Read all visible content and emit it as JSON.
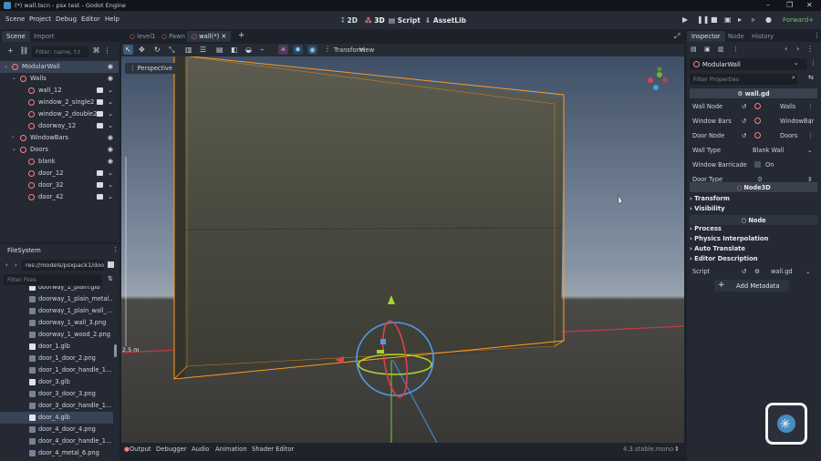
{
  "window": {
    "title": "(*) wall.tscn - psx test - Godot Engine",
    "min": "–",
    "max": "❐",
    "close": "✕"
  },
  "menu": [
    "Scene",
    "Project",
    "Debug",
    "Editor",
    "Help"
  ],
  "workspaces": {
    "w2d": "2D",
    "w3d": "3D",
    "script": "Script",
    "assetlib": "AssetLib"
  },
  "renderer": "Forward+",
  "scene_dock": {
    "tabs": [
      "Scene",
      "Import"
    ],
    "filter_placeholder": "Filter: name, t:t",
    "tree": [
      {
        "label": "ModularWall",
        "depth": 0,
        "sel": true,
        "arrow": "v"
      },
      {
        "label": "Walls",
        "depth": 1,
        "arrow": "v"
      },
      {
        "label": "wall_12",
        "depth": 2,
        "film": true
      },
      {
        "label": "window_2_single2",
        "depth": 2,
        "film": true
      },
      {
        "label": "window_2_double2",
        "depth": 2,
        "film": true
      },
      {
        "label": "doorway_12",
        "depth": 2,
        "film": true
      },
      {
        "label": "WindowBars",
        "depth": 1,
        "arrow": ">"
      },
      {
        "label": "Doors",
        "depth": 1,
        "arrow": "v"
      },
      {
        "label": "blank",
        "depth": 2
      },
      {
        "label": "door_12",
        "depth": 2,
        "film": true
      },
      {
        "label": "door_32",
        "depth": 2,
        "film": true
      },
      {
        "label": "door_42",
        "depth": 2,
        "film": true
      }
    ]
  },
  "filesystem": {
    "title": "FileSystem",
    "path": "res://models/psxpack1/doo",
    "filter_placeholder": "Filter Files",
    "files": [
      "doorway_1_plain.glb",
      "doorway_1_plain_metal...",
      "doorway_1_plain_wall_...",
      "doorway_1_wall_3.png",
      "doorway_1_wood_2.png",
      "door_1.glb",
      "door_1_door_2.png",
      "door_1_door_handle_1...",
      "door_3.glb",
      "door_3_door_3.png",
      "door_3_door_handle_1...",
      "door_4.glb",
      "door_4_door_4.png",
      "door_4_door_handle_1...",
      "door_4_metal_6.png"
    ],
    "selected": 11
  },
  "editor_tabs": [
    "level1",
    "Pawn",
    "wall(*)"
  ],
  "viewport": {
    "label": "Perspective",
    "menus": [
      "Transform",
      "View"
    ],
    "ruler": "2.5 m"
  },
  "bottom": {
    "tabs": [
      "Output",
      "Debugger",
      "Audio",
      "Animation",
      "Shader Editor"
    ],
    "version": "4.3.stable.mono"
  },
  "inspector": {
    "tabs": [
      "Inspector",
      "Node",
      "History"
    ],
    "node": "ModularWall",
    "filter_placeholder": "Filter Properties",
    "script_name": "wall.gd",
    "props": [
      {
        "k": "Wall Node",
        "v": "Walls"
      },
      {
        "k": "Window Bars",
        "v": "WindowBar"
      },
      {
        "k": "Door Node",
        "v": "Doors"
      },
      {
        "k": "Wall Type",
        "v": "Blank Wall"
      },
      {
        "k": "Window Barricade",
        "v": "On"
      },
      {
        "k": "Door Type",
        "v": "0"
      }
    ],
    "node3d": "Node3D",
    "node3d_sections": [
      "Transform",
      "Visibility"
    ],
    "node_header": "Node",
    "node_sections": [
      "Process",
      "Physics Interpolation",
      "Auto Translate",
      "Editor Description"
    ],
    "script_label": "Script",
    "script_value": "wall.gd",
    "add_metadata": "Add Metadata"
  },
  "colors": {
    "accent": "#478cbf",
    "node_icon": "#fc7f7f",
    "selection_box": "#ff9a1f",
    "renderer": "#6fc06f"
  }
}
